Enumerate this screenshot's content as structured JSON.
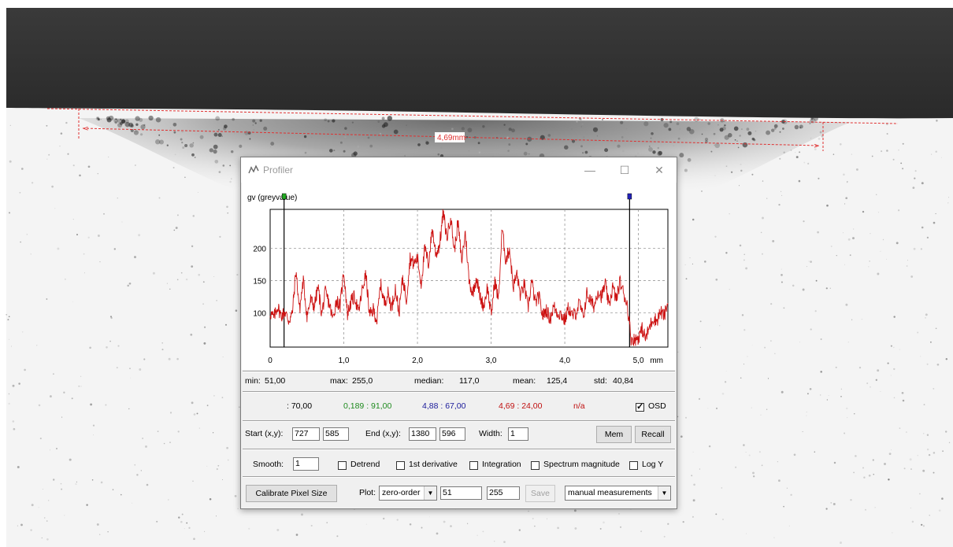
{
  "image_overlay": {
    "measurement_label": "4,69mm",
    "line_color": "#e03030"
  },
  "window": {
    "title": "Profiler",
    "minimize_icon": "minimize-icon",
    "maximize_icon": "maximize-icon",
    "close_icon": "close-icon"
  },
  "chart_data": {
    "type": "line",
    "ylabel": "gv (greyvalue)",
    "xlabel": "mm",
    "xlim": [
      0,
      5.4
    ],
    "ylim": [
      47,
      260
    ],
    "x_ticks": [
      "0",
      "1,0",
      "2,0",
      "3,0",
      "4,0",
      "5,0"
    ],
    "x_tick_values": [
      0,
      1,
      2,
      3,
      4,
      5
    ],
    "y_ticks": [
      "100",
      "150",
      "200"
    ],
    "y_tick_values": [
      100,
      150,
      200
    ],
    "grid": true,
    "line_color": "#cc1111",
    "cursors": [
      {
        "x": 0.189,
        "color": "#22aa22"
      },
      {
        "x": 4.88,
        "color": "#2222bb"
      }
    ],
    "series": [
      {
        "x": [
          0,
          0.05,
          0.1,
          0.15,
          0.2,
          0.25,
          0.3,
          0.35,
          0.4,
          0.45,
          0.5,
          0.55,
          0.6,
          0.65,
          0.7,
          0.75,
          0.8,
          0.85,
          0.9,
          0.95,
          1.0,
          1.05,
          1.1,
          1.15,
          1.2,
          1.25,
          1.3,
          1.35,
          1.4,
          1.45,
          1.5,
          1.55,
          1.6,
          1.65,
          1.7,
          1.75,
          1.8,
          1.85,
          1.9,
          1.95,
          2.0,
          2.05,
          2.1,
          2.15,
          2.2,
          2.25,
          2.3,
          2.35,
          2.4,
          2.45,
          2.5,
          2.55,
          2.6,
          2.65,
          2.7,
          2.75,
          2.8,
          2.85,
          2.9,
          2.95,
          3.0,
          3.05,
          3.1,
          3.15,
          3.2,
          3.25,
          3.3,
          3.35,
          3.4,
          3.45,
          3.5,
          3.55,
          3.6,
          3.65,
          3.7,
          3.75,
          3.8,
          3.85,
          3.9,
          3.95,
          4.0,
          4.05,
          4.1,
          4.15,
          4.2,
          4.25,
          4.3,
          4.35,
          4.4,
          4.45,
          4.5,
          4.55,
          4.6,
          4.65,
          4.7,
          4.75,
          4.8,
          4.85,
          4.9,
          4.95,
          5.0,
          5.05,
          5.1,
          5.15,
          5.2,
          5.25,
          5.3,
          5.35,
          5.4
        ],
        "values": [
          100,
          92,
          110,
          95,
          102,
          88,
          98,
          165,
          105,
          150,
          95,
          120,
          110,
          140,
          98,
          132,
          115,
          90,
          120,
          110,
          165,
          98,
          118,
          125,
          100,
          135,
          160,
          95,
          105,
          88,
          145,
          115,
          130,
          108,
          138,
          100,
          155,
          120,
          185,
          175,
          185,
          145,
          200,
          175,
          230,
          190,
          205,
          255,
          215,
          250,
          195,
          240,
          180,
          225,
          150,
          130,
          155,
          125,
          110,
          140,
          95,
          150,
          120,
          230,
          180,
          200,
          140,
          160,
          125,
          145,
          105,
          150,
          115,
          125,
          95,
          105,
          90,
          110,
          100,
          98,
          88,
          108,
          95,
          100,
          115,
          92,
          130,
          118,
          110,
          135,
          125,
          145,
          110,
          140,
          120,
          148,
          130,
          112,
          60,
          58,
          62,
          75,
          60,
          78,
          92,
          88,
          102,
          95,
          115
        ]
      }
    ]
  },
  "stats": {
    "min_label": "min:",
    "min_value": "51,00",
    "max_label": "max:",
    "max_value": "255,0",
    "median_label": "median:",
    "median_value": "117,0",
    "mean_label": "mean:",
    "mean_value": "125,4",
    "std_label": "std:",
    "std_value": "40,84"
  },
  "cursor_readout": {
    "v1": ": 70,00",
    "v1_color": "#000000",
    "v2": "0,189 : 91,00",
    "v2_color": "#1e8a1e",
    "v3": "4,88 : 67,00",
    "v3_color": "#1a1a9a",
    "v4": "4,69 : 24,00",
    "v4_color": "#c01010",
    "v5": "n/a",
    "v5_color": "#c01010",
    "osd_label": "OSD",
    "osd_checked": true
  },
  "coords": {
    "start_label": "Start (x,y):",
    "start_x": "727",
    "start_y": "585",
    "end_label": "End (x,y):",
    "end_x": "1380",
    "end_y": "596",
    "width_label": "Width:",
    "width_value": "1",
    "mem_label": "Mem",
    "recall_label": "Recall"
  },
  "options": {
    "smooth_label": "Smooth:",
    "smooth_value": "1",
    "detrend_label": "Detrend",
    "first_deriv_label": "1st derivative",
    "integration_label": "Integration",
    "spectrum_label": "Spectrum magnitude",
    "logy_label": "Log Y"
  },
  "bottom": {
    "calibrate_label": "Calibrate Pixel Size",
    "plot_label": "Plot:",
    "plot_mode": "zero-order",
    "range_min": "51",
    "range_max": "255",
    "save_label": "Save",
    "measure_mode": "manual measurements"
  }
}
